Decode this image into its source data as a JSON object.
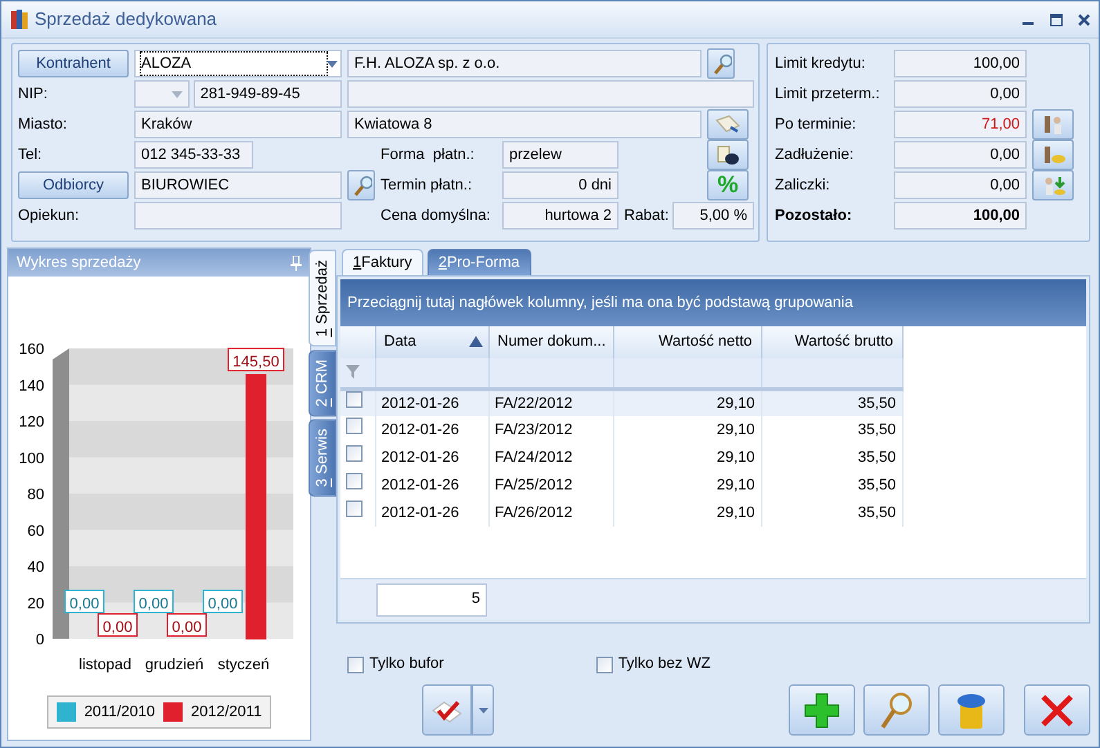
{
  "window": {
    "title": "Sprzedaż dedykowana"
  },
  "contractor": {
    "contractor_button": "Kontrahent",
    "code": "ALOZA",
    "name": "F.H. ALOZA sp. z o.o.",
    "nip_label": "NIP:",
    "nip": "281-949-89-45",
    "city_label": "Miasto:",
    "city": "Kraków",
    "street": "Kwiatowa 8",
    "tel_label": "Tel:",
    "tel": "012 345-33-33",
    "payment_form_label": "Forma  płatn.:",
    "payment_form": "przelew",
    "recipients_button": "Odbiorcy",
    "recipient": "BIUROWIEC",
    "payment_term_label": "Termin płatn.:",
    "payment_term": "0 dni",
    "percent_button": "%",
    "caretaker_label": "Opiekun:",
    "default_price_label": "Cena domyślna:",
    "default_price": "hurtowa 2",
    "discount_label": "Rabat:",
    "discount": "5,00 %"
  },
  "balance": [
    {
      "label": "Limit kredytu:",
      "value": "100,00",
      "kind": "plain",
      "overdue": false
    },
    {
      "label": "Limit przeterm.:",
      "value": "0,00",
      "kind": "plain",
      "overdue": false
    },
    {
      "label": "Po terminie:",
      "value": "71,00",
      "kind": "action",
      "overdue": true
    },
    {
      "label": "Zadłużenie:",
      "value": "0,00",
      "kind": "action",
      "overdue": false
    },
    {
      "label": "Zaliczki:",
      "value": "0,00",
      "kind": "action",
      "overdue": false
    },
    {
      "label": "Pozostało:",
      "value": "100,00",
      "kind": "total",
      "overdue": false
    }
  ],
  "chart_panel": {
    "title": "Wykres sprzedaży",
    "chart_data": {
      "type": "bar",
      "categories": [
        "listopad",
        "grudzień",
        "styczeń"
      ],
      "series": [
        {
          "name": "2011/2010",
          "color": "#2fb4d0",
          "values": [
            0,
            0,
            0
          ]
        },
        {
          "name": "2012/2011",
          "color": "#e0202c",
          "values": [
            0,
            0,
            145.5
          ]
        }
      ],
      "ylim": [
        0,
        160
      ],
      "yticks": [
        {
          "value": 0,
          "label": "0"
        },
        {
          "value": 20,
          "label": "20"
        },
        {
          "value": 40,
          "label": "40"
        },
        {
          "value": 60,
          "label": "60"
        },
        {
          "value": 80,
          "label": "80"
        },
        {
          "value": 100,
          "label": "100"
        },
        {
          "value": 120,
          "label": "120"
        },
        {
          "value": 140,
          "label": "140"
        },
        {
          "value": 160,
          "label": "160"
        }
      ],
      "value_labels": [
        [
          "0,00",
          "0,00",
          "0,00"
        ],
        [
          "0,00",
          "0,00",
          "145,50"
        ]
      ]
    }
  },
  "side_tabs": [
    {
      "hotkey": "1",
      "label": "Sprzedaż",
      "selected": true
    },
    {
      "hotkey": "2",
      "label": "CRM",
      "selected": false
    },
    {
      "hotkey": "3",
      "label": "Serwis",
      "selected": false
    }
  ],
  "doc_tabs": [
    {
      "hotkey": "1",
      "label": "Faktury",
      "selected": true
    },
    {
      "hotkey": "2",
      "label": "Pro-Forma",
      "selected": false
    }
  ],
  "grid": {
    "group_hint": "Przeciągnij tutaj nagłówek kolumny, jeśli ma ona być podstawą grupowania",
    "columns": [
      {
        "label": "Data",
        "kind": "text",
        "sorted": true
      },
      {
        "label": "Numer dokum...",
        "kind": "text",
        "sorted": false
      },
      {
        "label": "Wartość netto",
        "kind": "amount",
        "sorted": false
      },
      {
        "label": "Wartość brutto",
        "kind": "amount",
        "sorted": false
      }
    ],
    "rows": [
      {
        "cells": [
          "2012-01-26",
          "FA/22/2012",
          "29,10",
          "35,50"
        ],
        "checked": false,
        "selected": true
      },
      {
        "cells": [
          "2012-01-26",
          "FA/23/2012",
          "29,10",
          "35,50"
        ],
        "checked": false,
        "selected": false
      },
      {
        "cells": [
          "2012-01-26",
          "FA/24/2012",
          "29,10",
          "35,50"
        ],
        "checked": false,
        "selected": false
      },
      {
        "cells": [
          "2012-01-26",
          "FA/25/2012",
          "29,10",
          "35,50"
        ],
        "checked": false,
        "selected": false
      },
      {
        "cells": [
          "2012-01-26",
          "FA/26/2012",
          "29,10",
          "35,50"
        ],
        "checked": false,
        "selected": false
      }
    ],
    "footer_count": "5"
  },
  "filters": [
    {
      "label": "Tylko bufor",
      "checked": false
    },
    {
      "label": "Tylko bez WZ",
      "checked": false
    }
  ]
}
